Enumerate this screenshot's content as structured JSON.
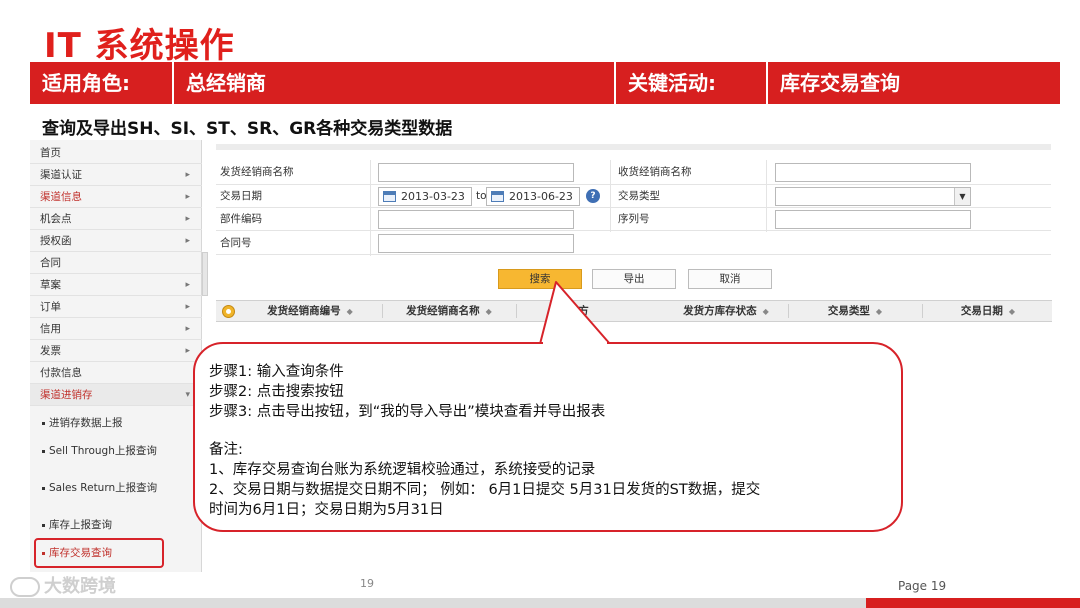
{
  "slide": {
    "title": "IT 系统操作",
    "subtitle": "查询及导出SH、SI、ST、SR、GR各种交易类型数据",
    "header": {
      "role_label": "适用角色:",
      "role_value": "总经销商",
      "activity_label": "关键活动:",
      "activity_value": "库存交易查询"
    },
    "page_center": "19",
    "page_right": "Page 19",
    "watermark": "大数跨境"
  },
  "sidebar": {
    "items": [
      {
        "label": "首页",
        "arrow": ""
      },
      {
        "label": "渠道认证",
        "arrow": "▸"
      },
      {
        "label": "渠道信息",
        "arrow": "▸"
      },
      {
        "label": "机会点",
        "arrow": "▸"
      },
      {
        "label": "授权函",
        "arrow": "▸"
      },
      {
        "label": "合同",
        "arrow": ""
      },
      {
        "label": "草案",
        "arrow": "▸"
      },
      {
        "label": "订单",
        "arrow": "▸"
      },
      {
        "label": "信用",
        "arrow": "▸"
      },
      {
        "label": "发票",
        "arrow": "▸"
      },
      {
        "label": "付款信息",
        "arrow": ""
      },
      {
        "label": "渠道进销存",
        "arrow": "▾"
      }
    ],
    "subitems": [
      "进销存数据上报",
      "Sell Through上报查询",
      "Sales Return上报查询",
      "库存上报查询",
      "库存交易查询"
    ]
  },
  "form": {
    "ship_dealer_name_label": "发货经销商名称",
    "recv_dealer_name_label": "收货经销商名称",
    "trade_date_label": "交易日期",
    "date_from": "2013-03-23",
    "to_label": "to",
    "date_to": "2013-06-23",
    "trade_type_label": "交易类型",
    "part_code_label": "部件编码",
    "serial_label": "序列号",
    "contract_label": "合同号",
    "help_glyph": "?"
  },
  "buttons": {
    "search": "搜索",
    "export": "导出",
    "cancel": "取消"
  },
  "grid": {
    "columns": [
      "发货经销商编号",
      "发货经销商名称",
      "发货方",
      "发货方库存状态",
      "交易类型",
      "交易日期"
    ],
    "sort_glyph": "◆"
  },
  "callout": {
    "steps": [
      "步骤1:   输入查询条件",
      "步骤2:   点击搜索按钮",
      "步骤3:  点击导出按钮，到“我的导入导出”模块查看并导出报表"
    ],
    "note_title": "备注:",
    "notes": [
      "1、库存交易查询台账为系统逻辑校验通过，系统接受的记录",
      "2、交易日期与数据提交日期不同；  例如：  6月1日提交  5月31日发货的ST数据，提交",
      "时间为6月1日；交易日期为5月31日"
    ]
  },
  "colors": {
    "brand_red": "#d71f1f",
    "title_red": "#e0201c",
    "search_button": "#f7b731"
  }
}
